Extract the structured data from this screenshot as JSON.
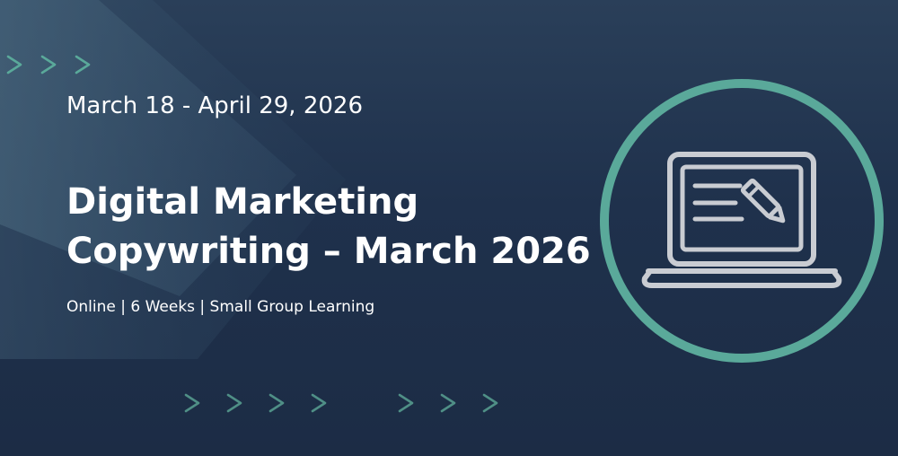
{
  "banner": {
    "dates": "March 18 - April 29, 2026",
    "title_line_1": "Digital Marketing",
    "title_line_2": "Copywriting – March 2026",
    "meta": "Online | 6 Weeks | Small Group Learning"
  },
  "icons": {
    "illustration": "laptop-with-document-and-pencil-icon",
    "decoration": "chevron-right-icon"
  },
  "colors": {
    "background_top": "#2a3f59",
    "background_bottom": "#1c2c45",
    "accent_teal": "#5aa99a",
    "icon_gray": "#c9ccd2",
    "text": "#ffffff"
  }
}
